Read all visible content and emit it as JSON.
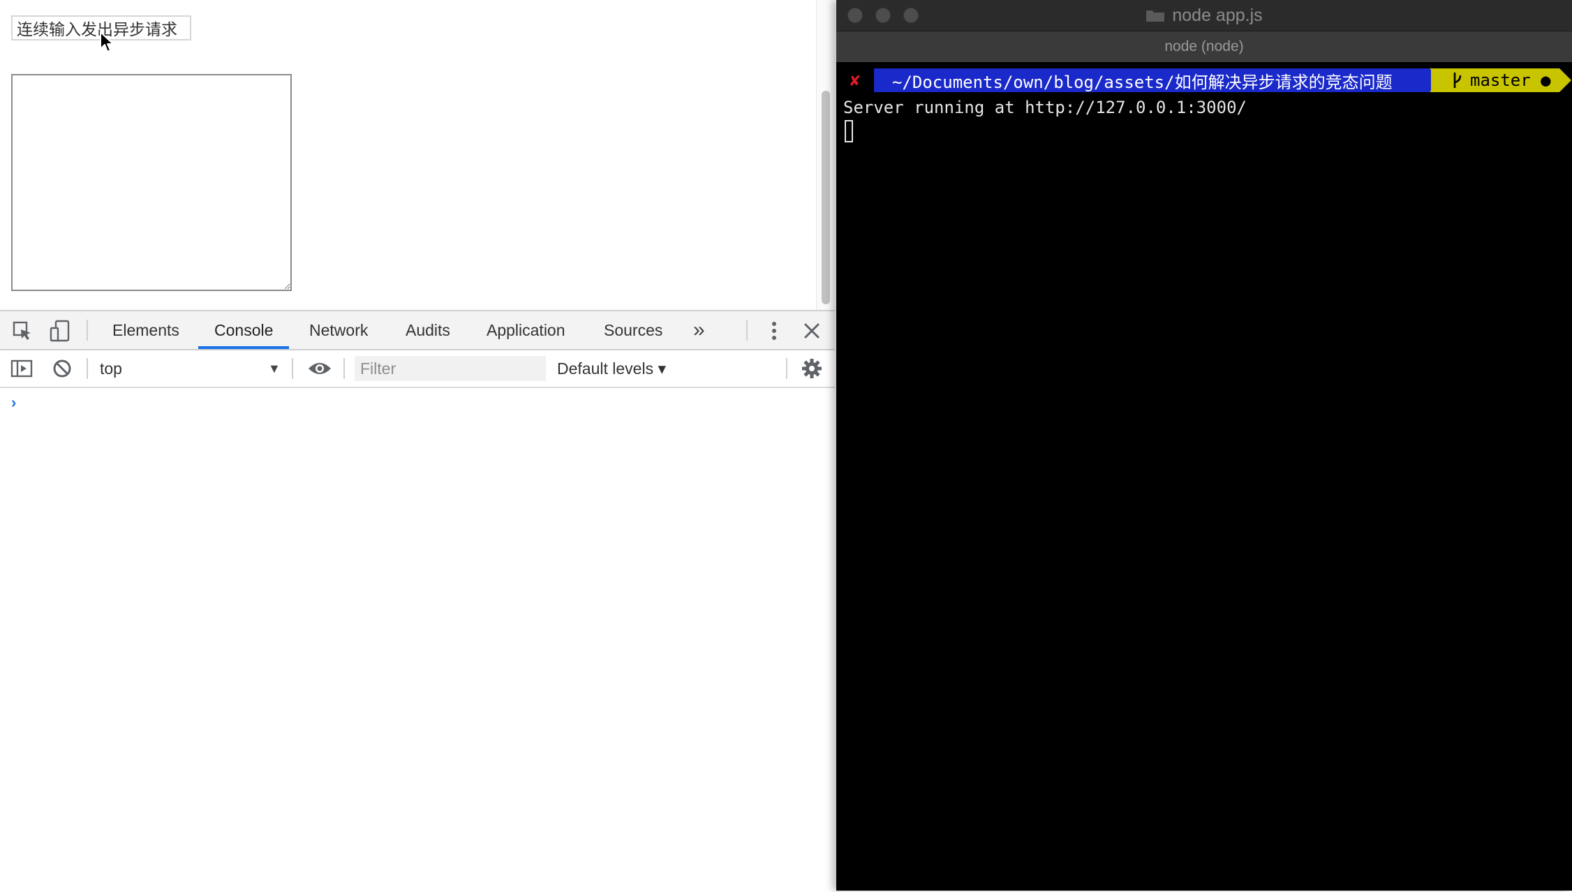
{
  "page": {
    "input_value": "连续输入发出异步请求",
    "textarea_value": ""
  },
  "devtools": {
    "tabs": [
      {
        "label": "Elements"
      },
      {
        "label": "Console",
        "active": true
      },
      {
        "label": "Network"
      },
      {
        "label": "Audits"
      },
      {
        "label": "Application"
      },
      {
        "label": "Sources"
      }
    ],
    "more_tabs": "»",
    "console": {
      "context": "top",
      "filter_placeholder": "Filter",
      "filter_value": "",
      "levels": "Default levels ▾",
      "prompt": "›"
    },
    "accent_color": "#1a73e8"
  },
  "terminal": {
    "window_title": "node app.js",
    "tab_title": "node (node)",
    "prompt": {
      "status_symbol": "✘",
      "path": "~/Documents/own/blog/assets/如何解决异步请求的竞态问题",
      "branch": "master ●",
      "branch_icon": "git-branch-icon",
      "path_bg": "#1a29c9",
      "branch_bg": "#c9c400",
      "status_color": "#e01b24"
    },
    "output": [
      "Server running at http://127.0.0.1:3000/"
    ]
  }
}
